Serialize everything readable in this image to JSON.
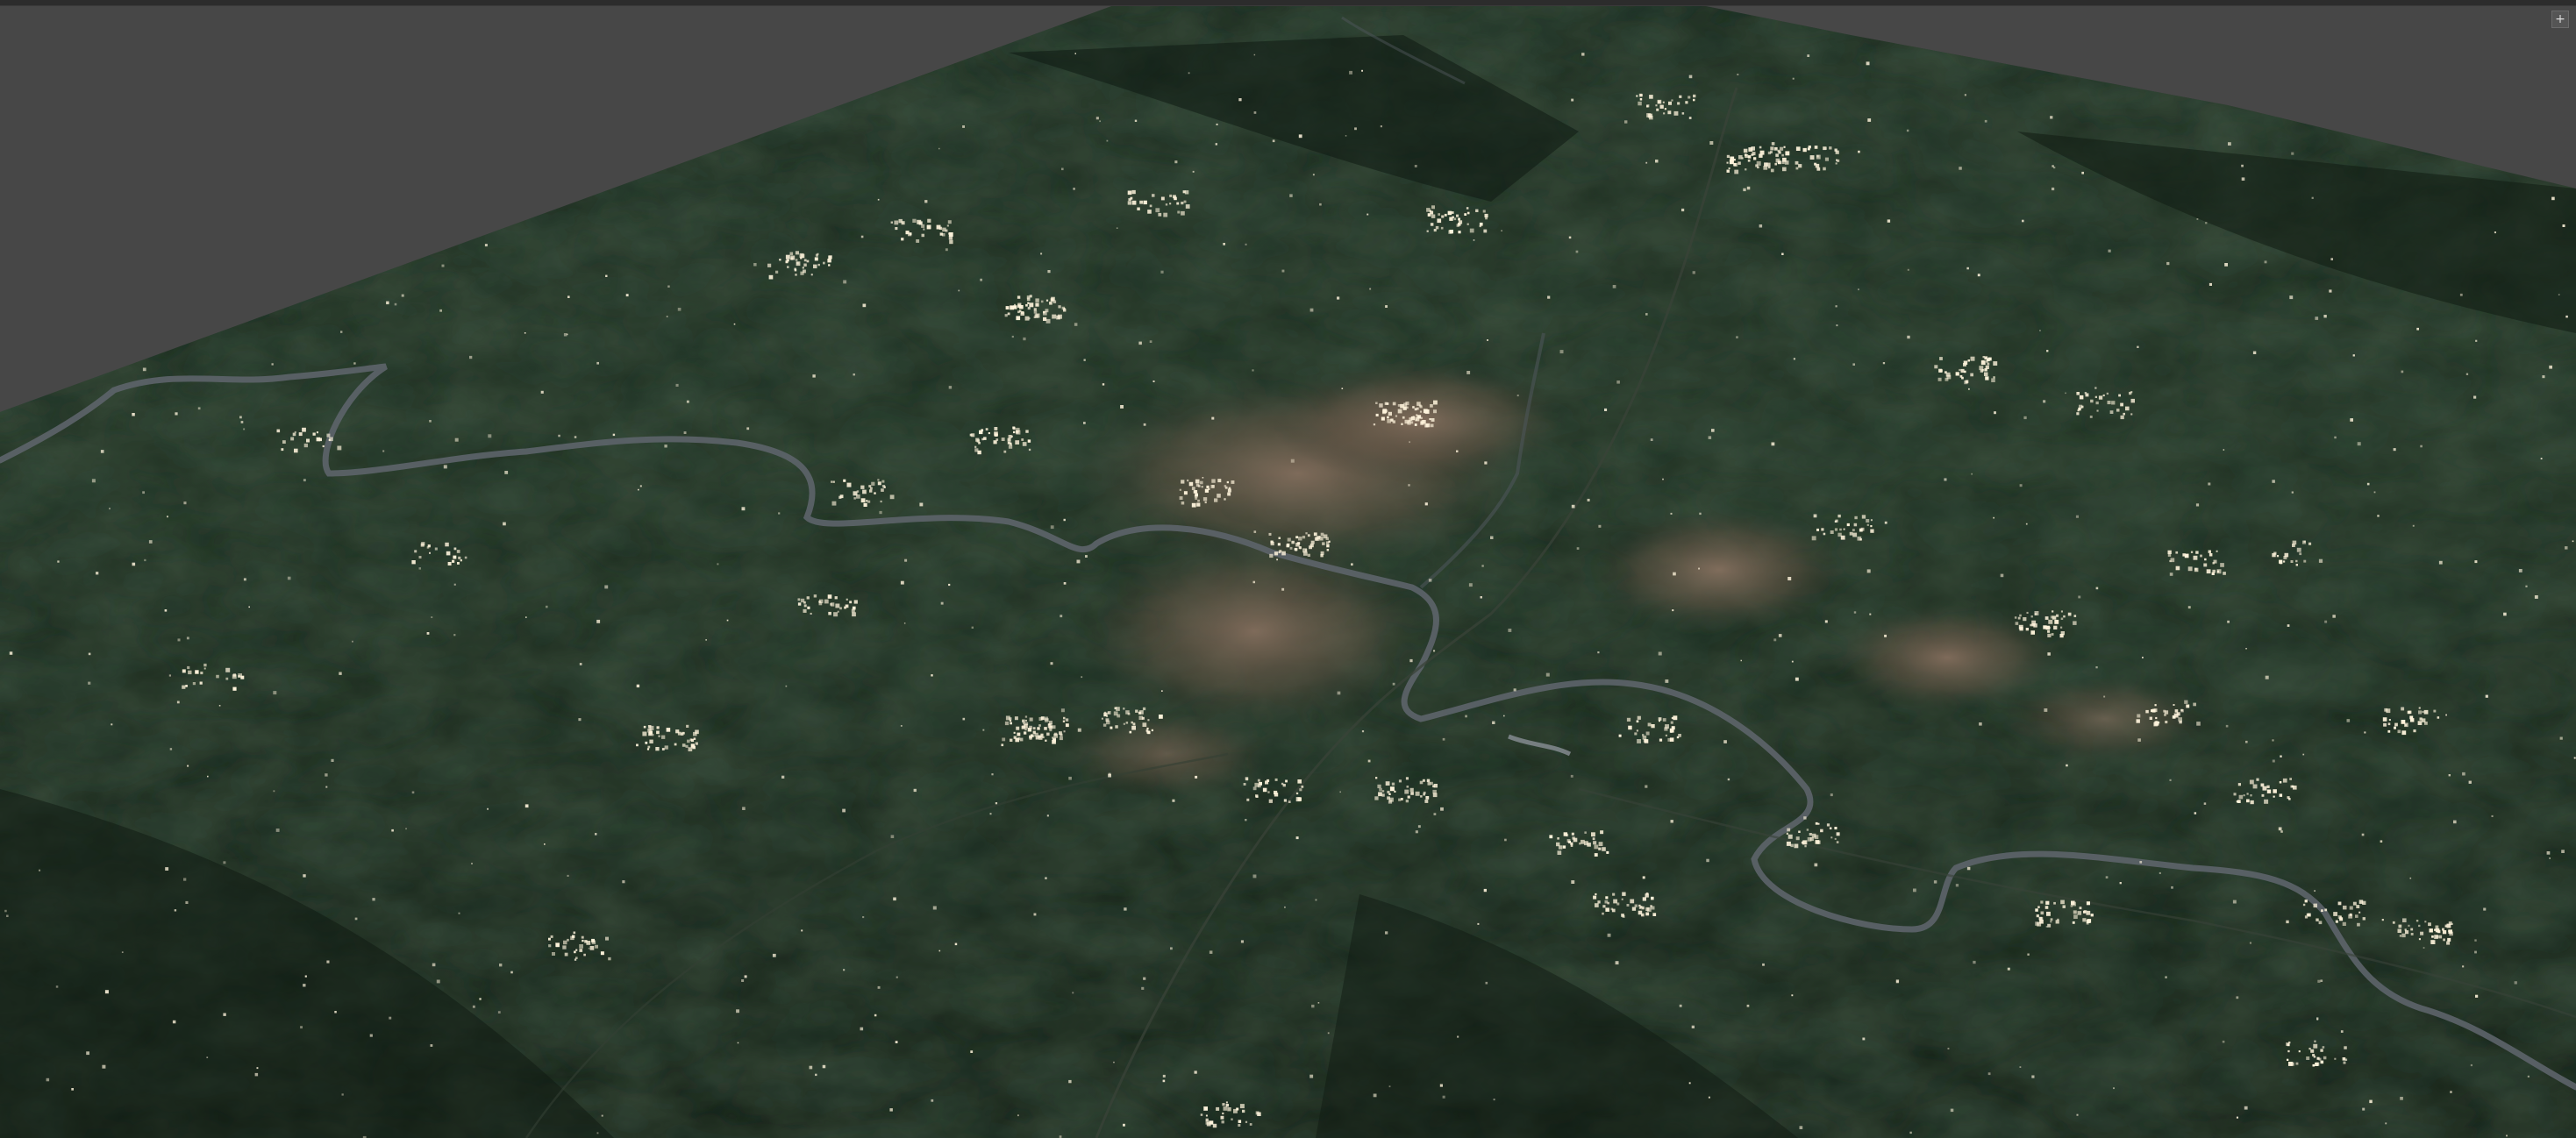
{
  "viewport": {
    "background_color": "#474747",
    "terrain_colors": {
      "forest_dark": "#16231a",
      "forest_mid": "#223524",
      "urban_tan": "#8b7262",
      "lights": "#fff6e0",
      "river": "#5a6066"
    }
  },
  "corner_button": {
    "icon": "plus-icon",
    "glyph": "+"
  }
}
